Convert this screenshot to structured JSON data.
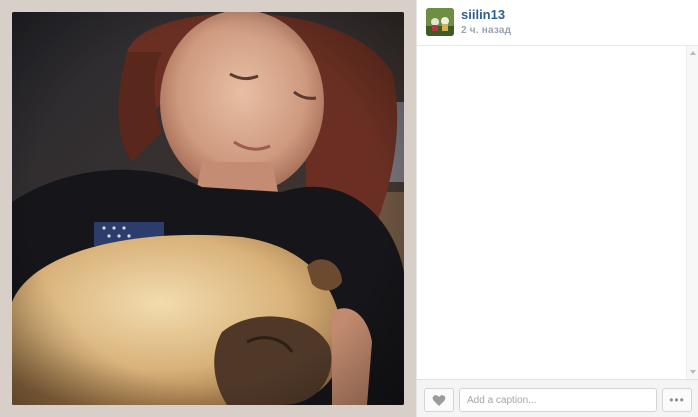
{
  "post": {
    "username": "siilin13",
    "timestamp": "2 ч. назад"
  },
  "comment_box": {
    "placeholder": "Add a caption..."
  },
  "icons": {
    "like": "heart-icon",
    "more": "more-options-icon",
    "more_glyph": "•••"
  },
  "colors": {
    "username": "#2f5f8e",
    "timestamp": "#9aa3ab",
    "photo_border": "#d7cfc8"
  }
}
